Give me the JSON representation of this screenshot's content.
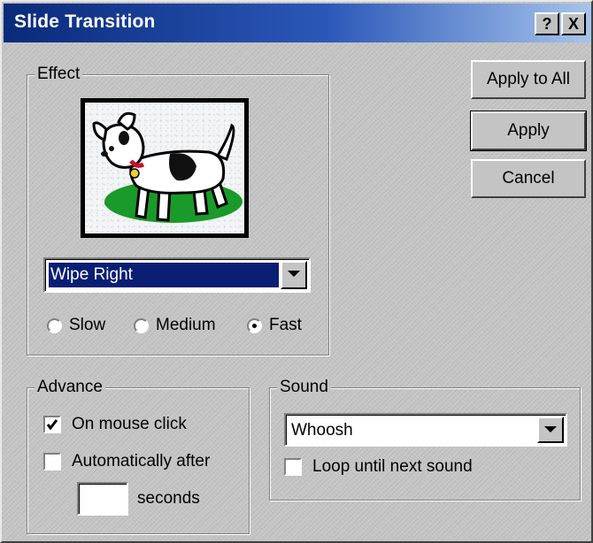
{
  "window": {
    "title": "Slide Transition",
    "help_label": "?",
    "close_label": "X"
  },
  "effect": {
    "label": "Effect",
    "transition_value": "Wipe Right",
    "speed": {
      "options": [
        "Slow",
        "Medium",
        "Fast"
      ],
      "selected": "Fast"
    }
  },
  "buttons": {
    "apply_all": "Apply to All",
    "apply": "Apply",
    "cancel": "Cancel"
  },
  "advance": {
    "label": "Advance",
    "on_mouse_click": {
      "label": "On mouse click",
      "checked": true
    },
    "automatically_after": {
      "label": "Automatically after",
      "checked": false
    },
    "seconds_value": "",
    "seconds_label": "seconds"
  },
  "sound": {
    "label": "Sound",
    "value": "Whoosh",
    "loop": {
      "label": "Loop until next sound",
      "checked": false
    }
  }
}
